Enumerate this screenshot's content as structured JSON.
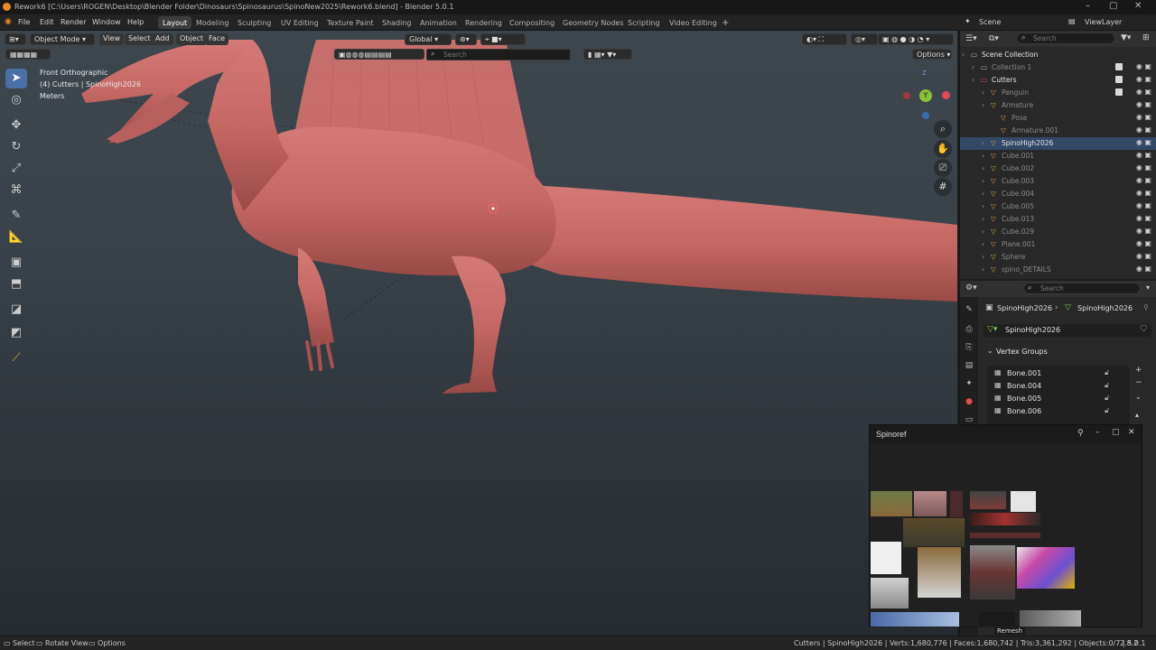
{
  "titlebar": {
    "title": "Rework6 [C:\\Users\\ROGEN\\Desktop\\Blender Folder\\Dinosaurs\\Spinosaurus\\SpinoNew2025\\Rework6.blend] - Blender 5.0.1"
  },
  "menu": [
    "File",
    "Edit",
    "Render",
    "Window",
    "Help"
  ],
  "workspaces": [
    "Layout",
    "Modeling",
    "Sculpting",
    "UV Editing",
    "Texture Paint",
    "Shading",
    "Animation",
    "Rendering",
    "Compositing",
    "Geometry Nodes",
    "Scripting",
    "Video Editing"
  ],
  "workspace_add": "+",
  "scene": {
    "label": "Scene"
  },
  "view_layer": {
    "label": "ViewLayer"
  },
  "viewport": {
    "mode": "Object Mode",
    "menus": [
      "View",
      "Select",
      "Add",
      "Object",
      "Face"
    ],
    "orientation": "Global",
    "search_placeholder": "Search",
    "options": "Options",
    "overlay": [
      "Front Orthographic",
      "(4) Cutters | SpinoHigh2026",
      "Meters"
    ],
    "gizmo": {
      "z": "Z",
      "y": "Y",
      "x": "X"
    }
  },
  "outliner": {
    "search_placeholder": "Search",
    "rows": [
      {
        "label": "Scene Collection",
        "indent": 0
      },
      {
        "label": "Collection 1",
        "indent": 1,
        "dim": true
      },
      {
        "label": "Cutters",
        "indent": 1
      },
      {
        "label": "Penguin",
        "indent": 2,
        "dim": true
      },
      {
        "label": "Armature",
        "indent": 2,
        "dim": true
      },
      {
        "label": "Pose",
        "indent": 3,
        "dim": true
      },
      {
        "label": "Armature.001",
        "indent": 3,
        "dim": true
      },
      {
        "label": "SpinoHigh2026",
        "indent": 2
      },
      {
        "label": "Cube.001",
        "indent": 2,
        "dim": true
      },
      {
        "label": "Cube.002",
        "indent": 2,
        "dim": true
      },
      {
        "label": "Cube.003",
        "indent": 2,
        "dim": true
      },
      {
        "label": "Cube.004",
        "indent": 2,
        "dim": true
      },
      {
        "label": "Cube.005",
        "indent": 2,
        "dim": true
      },
      {
        "label": "Cube.013",
        "indent": 2,
        "dim": true
      },
      {
        "label": "Cube.029",
        "indent": 2,
        "dim": true
      },
      {
        "label": "Plane.001",
        "indent": 2,
        "dim": true
      },
      {
        "label": "Sphere",
        "indent": 2,
        "dim": true
      },
      {
        "label": "spino_DETAILS",
        "indent": 2,
        "dim": true
      }
    ]
  },
  "properties": {
    "search_placeholder": "Search",
    "breadcrumb": [
      "SpinoHigh2026",
      "SpinoHigh2026"
    ],
    "mesh_name": "SpinoHigh2026",
    "panel": "Vertex Groups",
    "groups": [
      "Bone.001",
      "Bone.004",
      "Bone.005",
      "Bone.006"
    ]
  },
  "reference_window": {
    "title": "Spinoref",
    "footer_label": "Remesh"
  },
  "status": {
    "left": [
      "Select",
      "Rotate View",
      "Options"
    ],
    "stats": "Cutters | SpinoHigh2026 | Verts:1,680,776 | Faces:1,680,742 | Tris:3,361,292 | Objects:0/7 | 5.0.1",
    "right": "2.8.2"
  },
  "colors": {
    "model": "#c86b68",
    "accent": "#4a6fa5",
    "active_workspace": "#3d3d3d"
  }
}
